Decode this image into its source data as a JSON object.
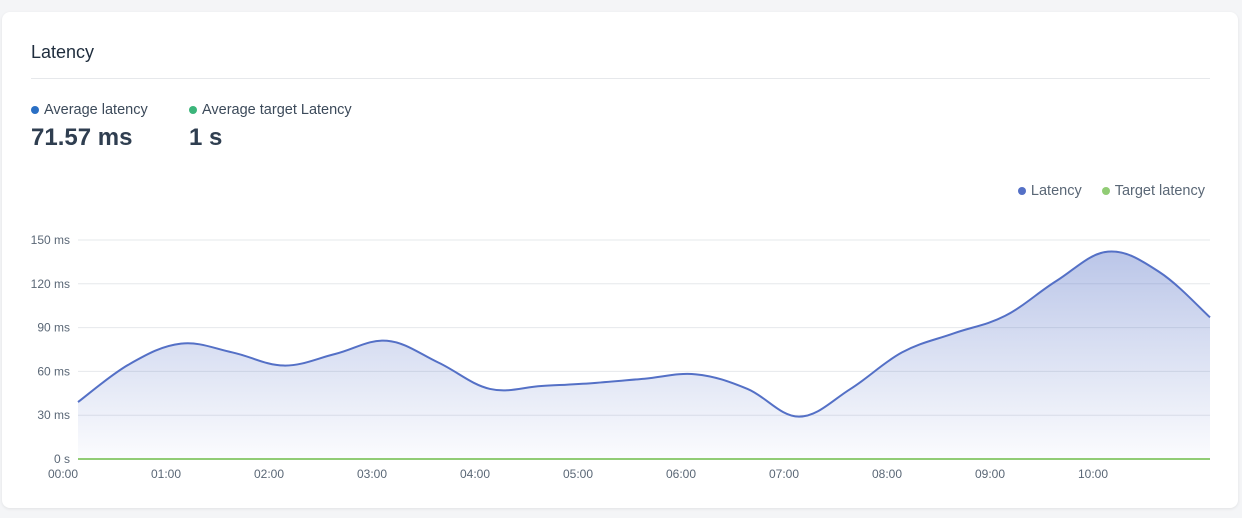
{
  "card": {
    "title": "Latency"
  },
  "stats": [
    {
      "label": "Average latency",
      "value": "71.57 ms",
      "color": "#2a6fc4"
    },
    {
      "label": "Average target Latency",
      "value": "1 s",
      "color": "#3bb57a"
    }
  ],
  "colors": {
    "latency": "#5470c6",
    "target": "#91cc75",
    "grid": "#e6e8eb"
  },
  "chart_data": {
    "type": "area",
    "x": [
      "00:00",
      "00:30",
      "01:00",
      "01:30",
      "02:00",
      "02:30",
      "03:00",
      "03:30",
      "04:00",
      "04:30",
      "05:00",
      "05:30",
      "06:00",
      "06:30",
      "07:00",
      "07:30",
      "08:00",
      "08:30",
      "09:00",
      "09:30",
      "10:00",
      "10:30",
      "11:00"
    ],
    "x_tick_labels": [
      "00:00",
      "01:00",
      "02:00",
      "03:00",
      "04:00",
      "05:00",
      "06:00",
      "07:00",
      "08:00",
      "09:00",
      "10:00"
    ],
    "y_tick_labels": [
      "0 s",
      "30 ms",
      "60 ms",
      "90 ms",
      "120 ms",
      "150 ms"
    ],
    "y_ticks": [
      0,
      30,
      60,
      90,
      120,
      150
    ],
    "ylim": [
      0,
      150
    ],
    "series": [
      {
        "name": "Latency",
        "values": [
          39,
          65,
          79,
          73,
          64,
          72,
          81,
          66,
          48,
          50,
          52,
          55,
          58,
          48,
          29,
          48,
          73,
          86,
          98,
          122,
          142,
          128,
          97
        ]
      },
      {
        "name": "Target latency",
        "values": [
          0,
          0,
          0,
          0,
          0,
          0,
          0,
          0,
          0,
          0,
          0,
          0,
          0,
          0,
          0,
          0,
          0,
          0,
          0,
          0,
          0,
          0,
          0
        ]
      }
    ],
    "legend": "top-right",
    "grid": true
  }
}
